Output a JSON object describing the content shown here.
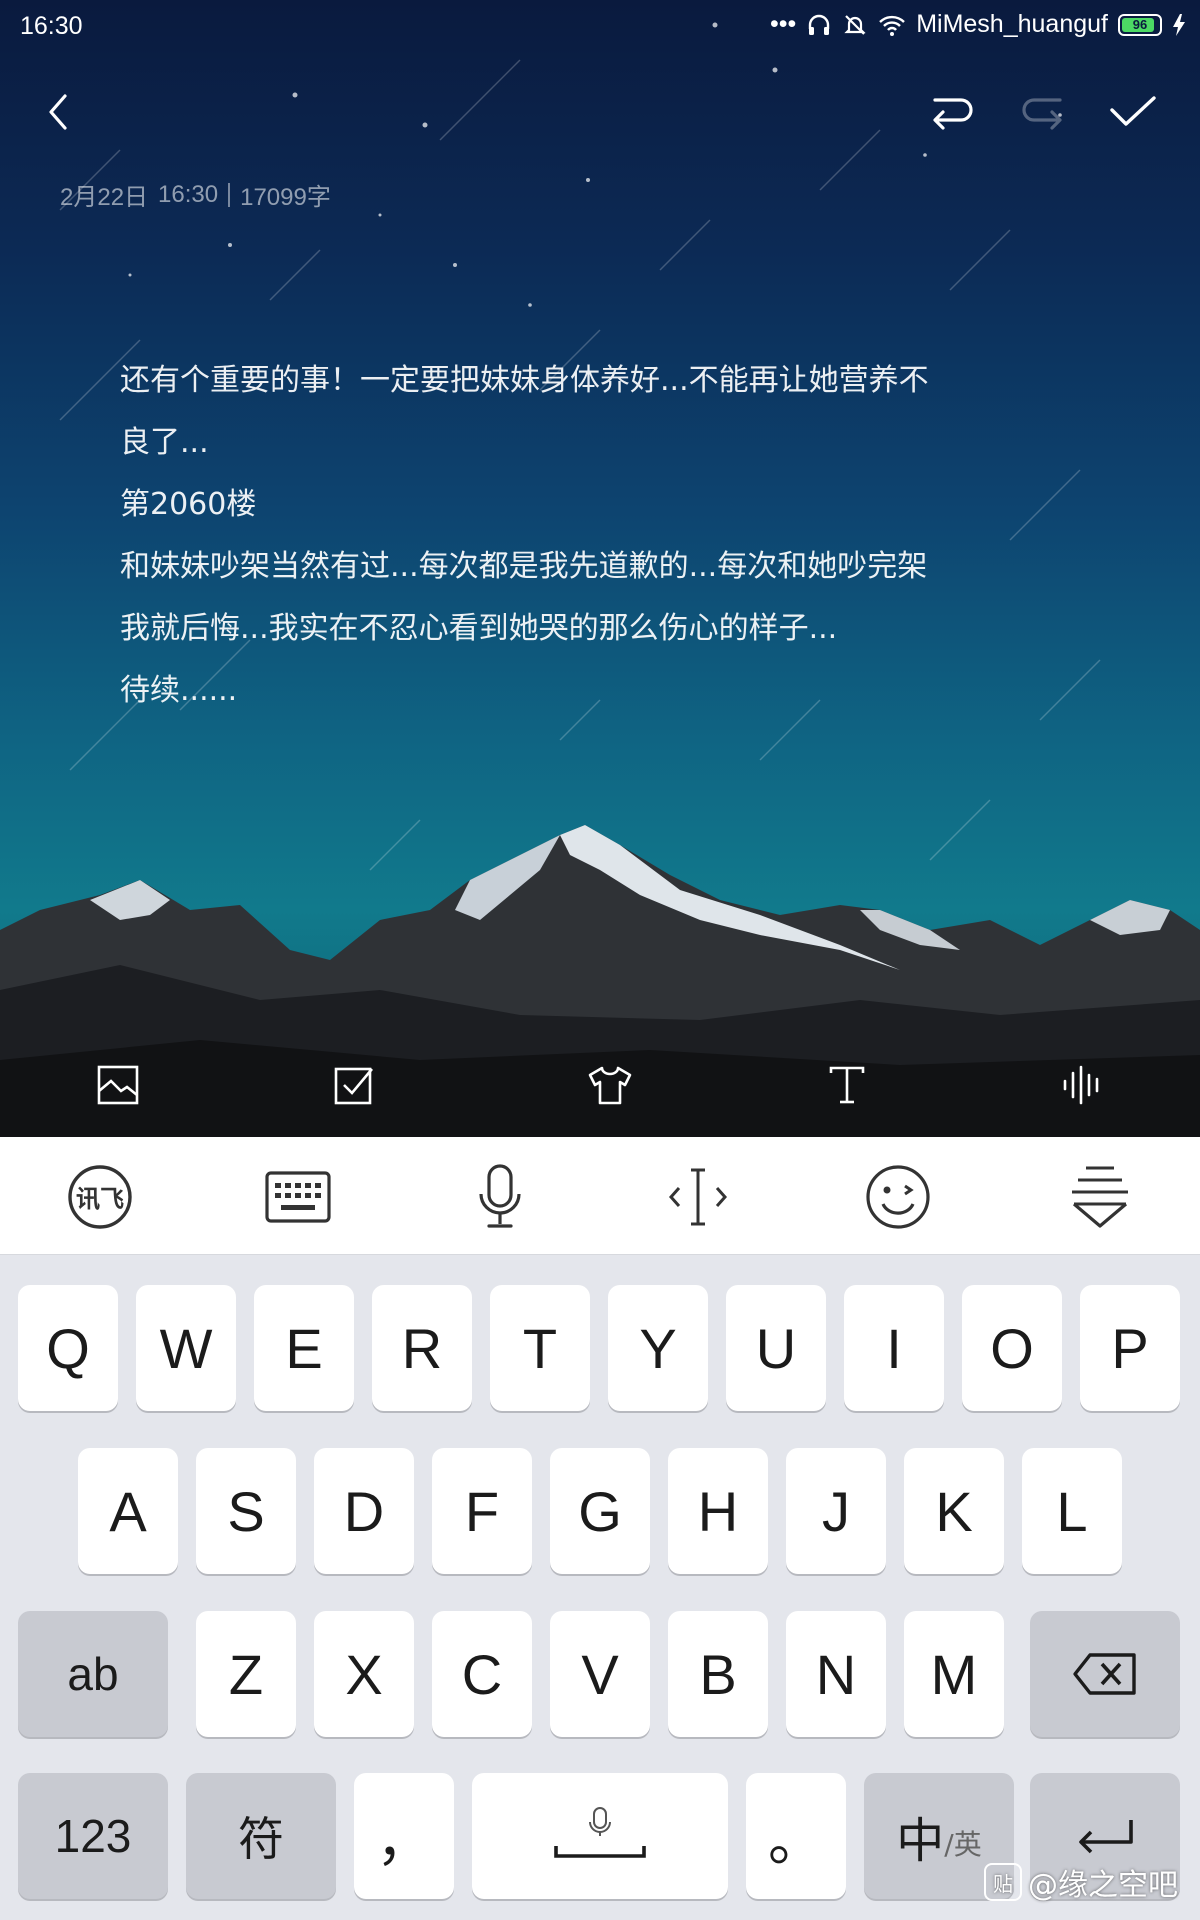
{
  "status_bar": {
    "time": "16:30",
    "wifi_name": "MiMesh_huanguf",
    "battery_level": "96",
    "battery_color": "#4cd964"
  },
  "top_bar": {
    "back_icon": "chevron-left-icon",
    "undo_icon": "undo-icon",
    "redo_icon": "redo-icon",
    "confirm_icon": "check-icon"
  },
  "note": {
    "date": "2月22日",
    "time": "16:30",
    "word_count": "17099字",
    "lines": [
      "还有个重要的事！一定要把妹妹身体养好...不能再让她营养不",
      "良了...",
      "第2060楼",
      "和妹妹吵架当然有过...每次都是我先道歉的...每次和她吵完架",
      "我就后悔...我实在不忍心看到她哭的那么伤心的样子...",
      "待续......"
    ]
  },
  "format_bar": {
    "items": [
      "image-icon",
      "checklist-icon",
      "theme-shirt-icon",
      "text-format-icon",
      "audio-icon"
    ]
  },
  "ime_toolbar": {
    "items": [
      "ifly-logo-icon",
      "keyboard-icon",
      "microphone-icon",
      "cursor-move-icon",
      "emoji-icon",
      "hide-keyboard-icon"
    ],
    "ifly_label": "讯飞"
  },
  "keyboard": {
    "row1": [
      "Q",
      "W",
      "E",
      "R",
      "T",
      "Y",
      "U",
      "I",
      "O",
      "P"
    ],
    "row2": [
      "A",
      "S",
      "D",
      "F",
      "G",
      "H",
      "J",
      "K",
      "L"
    ],
    "row3": [
      "Z",
      "X",
      "C",
      "V",
      "B",
      "N",
      "M"
    ],
    "ab_key": "ab",
    "num_key": "123",
    "symbol_key": "符",
    "comma_key": "，",
    "period_key": "。",
    "lang_main": "中",
    "lang_sub": "/英"
  },
  "watermark": {
    "badge": "贴",
    "text": "@缘之空吧"
  }
}
